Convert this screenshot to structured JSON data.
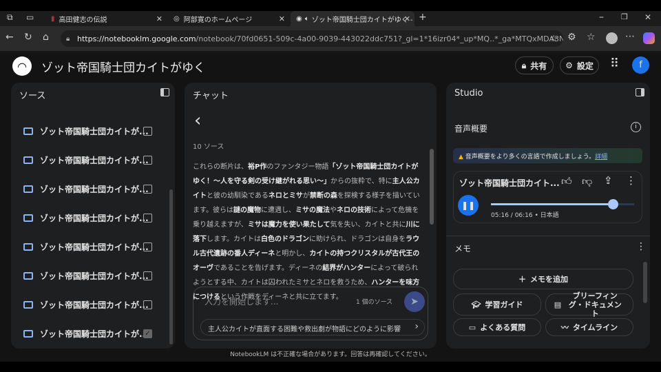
{
  "browser": {
    "tabs": [
      {
        "label": "高田健志の伝説"
      },
      {
        "label": "阿部寛のホームページ"
      },
      {
        "label": "ゾット帝国騎士団カイトがゆく -"
      }
    ],
    "url_host": "https://notebooklm.google.com",
    "url_path": "/notebook/70fd0651-509c-4a00-9039-443022ddc751?_gl=1*16izr04*_up*MQ..*_ga*MTQxMDA3NjYyOS4x..."
  },
  "header": {
    "title": "ゾット帝国騎士団カイトがゆく",
    "share": "共有",
    "settings": "設定",
    "avatar": "f"
  },
  "sources": {
    "title": "ソース",
    "items": [
      {
        "label": "ゾット帝国騎士団カイトが...",
        "checked": false
      },
      {
        "label": "ゾット帝国騎士団カイトが...",
        "checked": false
      },
      {
        "label": "ゾット帝国騎士団カイトが...",
        "checked": false
      },
      {
        "label": "ゾット帝国騎士団カイトが...",
        "checked": false
      },
      {
        "label": "ゾット帝国騎士団カイトが...",
        "checked": false
      },
      {
        "label": "ゾット帝国騎士団カイトが...",
        "checked": false
      },
      {
        "label": "ゾット帝国騎士団カイトが...",
        "checked": false
      },
      {
        "label": "ゾット帝国騎士団カイトが...",
        "checked": true
      }
    ]
  },
  "chat": {
    "title": "チャット",
    "source_count": "10 ソース",
    "summary": [
      {
        "t": "これらの断片は、",
        "b": false
      },
      {
        "t": "裕P作",
        "b": true
      },
      {
        "t": "のファンタジー物語",
        "b": false
      },
      {
        "t": "「ゾット帝国騎士団カイトがゆく！〜人を守る剣の受け継がれる思い〜」",
        "b": true
      },
      {
        "t": "からの抜粋で、特に",
        "b": false
      },
      {
        "t": "主人公カイト",
        "b": true
      },
      {
        "t": "と彼の幼馴染である",
        "b": false
      },
      {
        "t": "ネロとミサ",
        "b": true
      },
      {
        "t": "が",
        "b": false
      },
      {
        "t": "禁断の森",
        "b": true
      },
      {
        "t": "を探検する様子を描いています。彼らは",
        "b": false
      },
      {
        "t": "謎の魔物",
        "b": true
      },
      {
        "t": "に遭遇し、",
        "b": false
      },
      {
        "t": "ミサの魔法",
        "b": true
      },
      {
        "t": "や",
        "b": false
      },
      {
        "t": "ネロの技術",
        "b": true
      },
      {
        "t": "によって危機を乗り越えますが、",
        "b": false
      },
      {
        "t": "ミサは魔力を使い果たして",
        "b": true
      },
      {
        "t": "気を失い、カイトと共に",
        "b": false
      },
      {
        "t": "川に落下",
        "b": true
      },
      {
        "t": "します。カイトは",
        "b": false
      },
      {
        "t": "白色のドラゴン",
        "b": true
      },
      {
        "t": "に助けられ、ドラゴンは自身を",
        "b": false
      },
      {
        "t": "ラウル古代遺跡の番人ディーネ",
        "b": true
      },
      {
        "t": "と明かし、",
        "b": false
      },
      {
        "t": "カイトの持つクリスタルが古代王のオーヴ",
        "b": true
      },
      {
        "t": "であることを告げます。ディーネの",
        "b": false
      },
      {
        "t": "結界がハンター",
        "b": true
      },
      {
        "t": "によって破られようとする中、カイトは囚われたミサとネロを救うため、",
        "b": false
      },
      {
        "t": "ハンターを味方につける",
        "b": true
      },
      {
        "t": "という作戦をディーネと共に立てます。",
        "b": false
      }
    ],
    "input_placeholder": "入力を開始します...",
    "input_sources": "1 個のソース",
    "suggestion": "主人公カイトが直面する困難や救出劇が物語にどのように影響"
  },
  "studio": {
    "title": "Studio",
    "audio_title": "音声概要",
    "banner": "音声概要をより多くの言語で作成しましょう。",
    "banner_link": "詳細",
    "player": {
      "title": "ゾット帝国騎士団カイト...",
      "time": "05:16 / 06:16",
      "lang": "日本語",
      "progress": 0.85
    },
    "memo_title": "メモ",
    "add_memo": "メモを追加",
    "buttons": [
      "学習ガイド",
      "ブリーフィング・ドキュメント",
      "よくある質問",
      "タイムライン"
    ]
  },
  "footer": "NotebookLM は不正確な場合があります。回答は再確認してください。"
}
